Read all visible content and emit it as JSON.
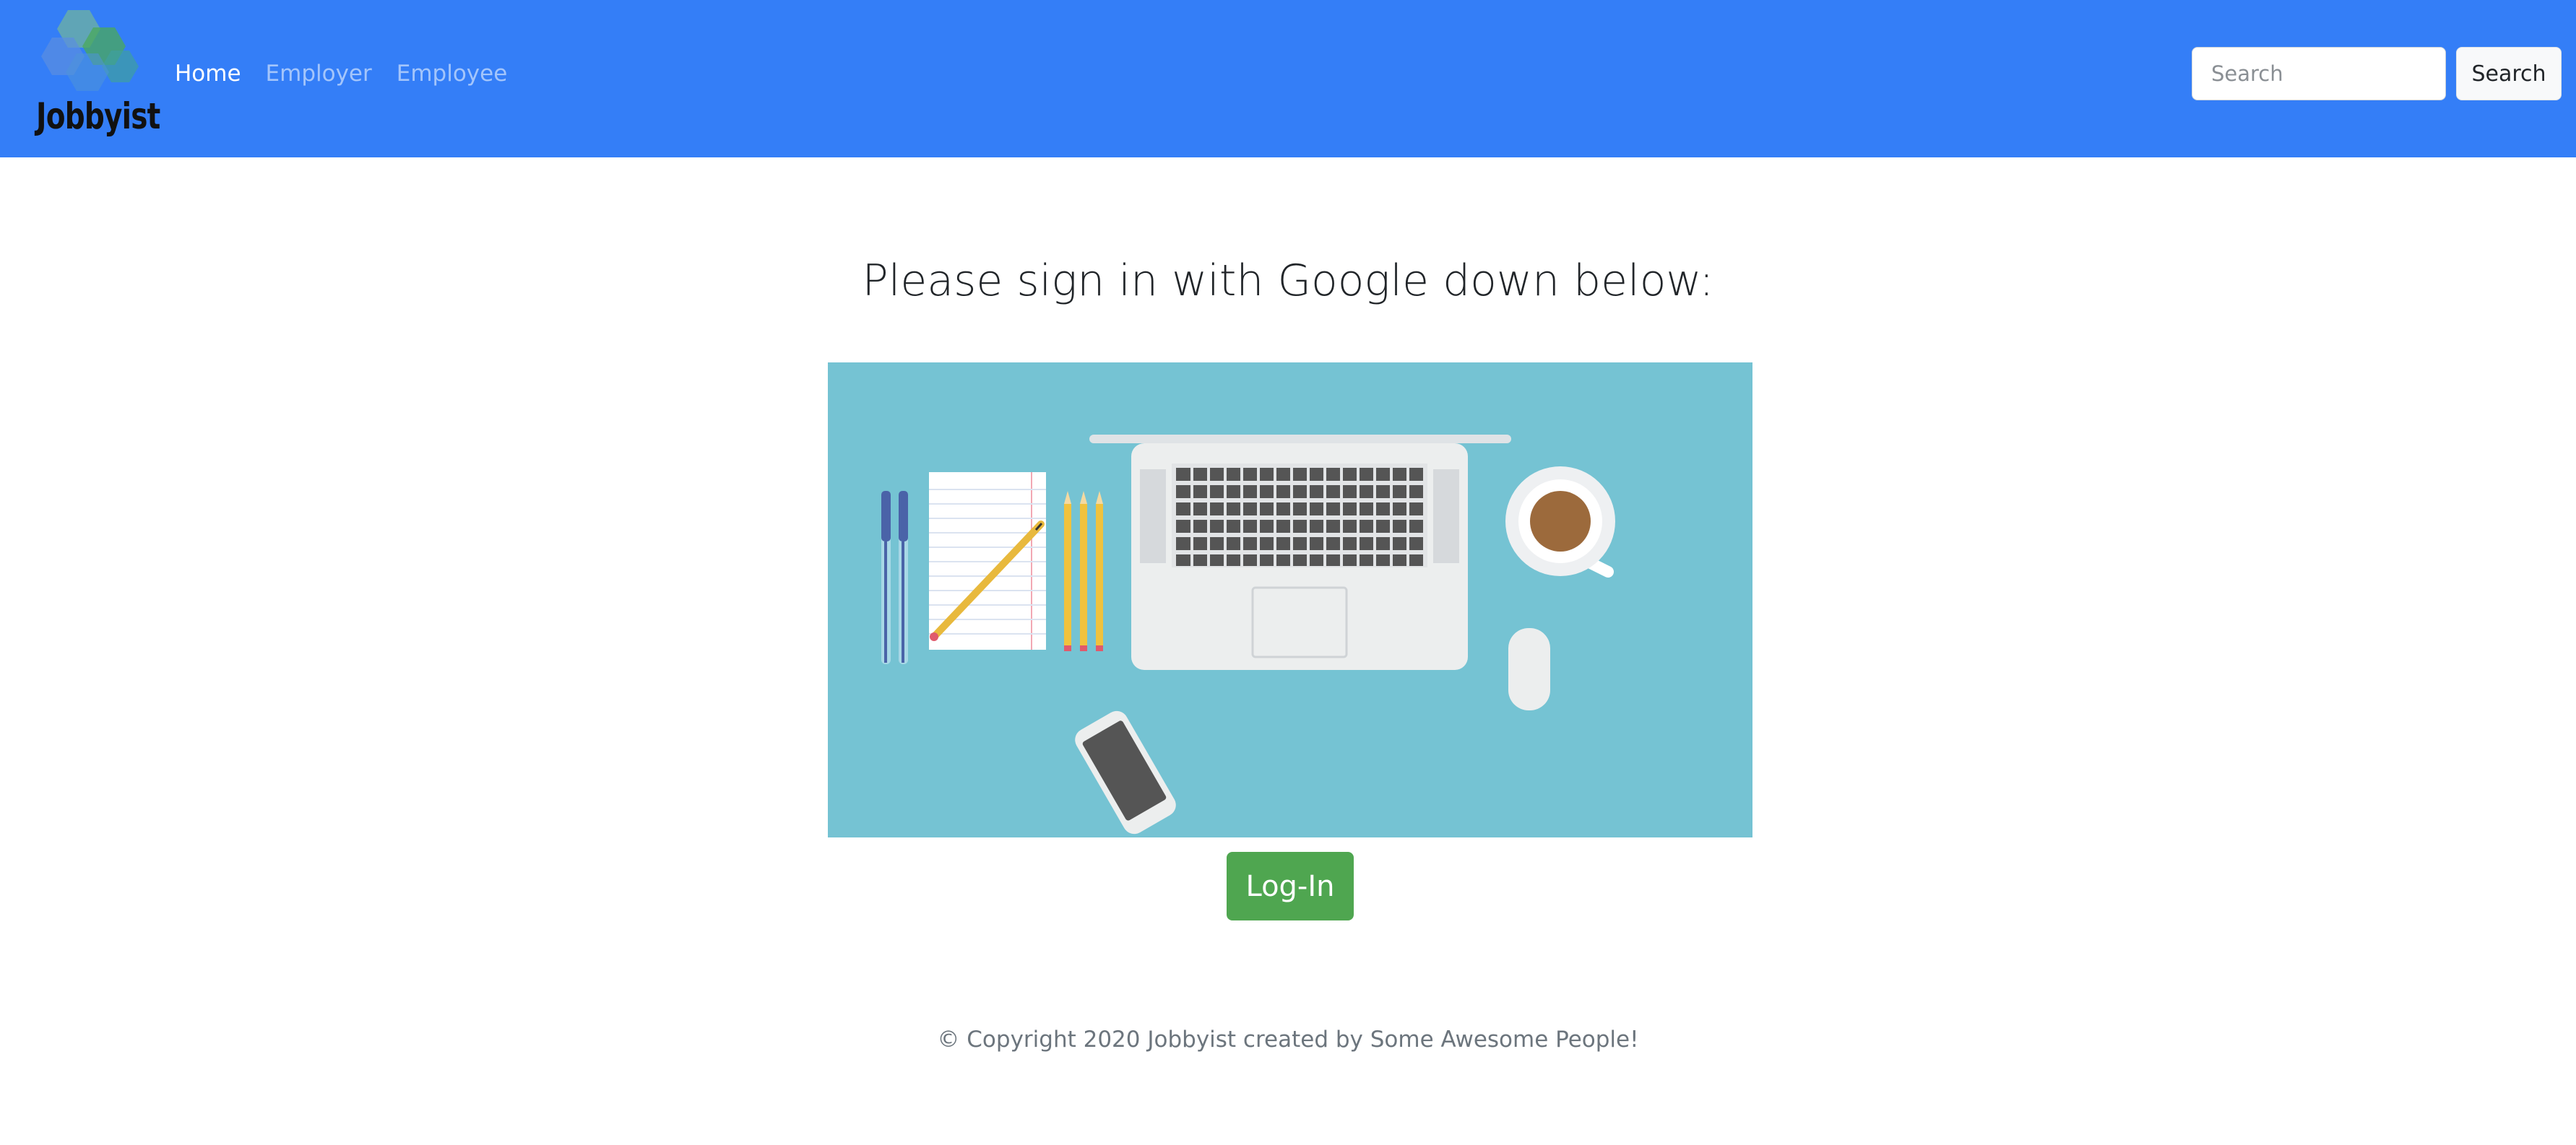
{
  "brand": {
    "name": "Jobbyist"
  },
  "nav": {
    "items": [
      {
        "label": "Home",
        "active": true
      },
      {
        "label": "Employer",
        "active": false
      },
      {
        "label": "Employee",
        "active": false
      }
    ]
  },
  "search": {
    "placeholder": "Search",
    "button_label": "Search"
  },
  "main": {
    "heading": "Please sign in with Google down below:",
    "login_label": "Log-In"
  },
  "footer": {
    "text": "© Copyright 2020 Jobbyist created by Some Awesome People!"
  },
  "colors": {
    "navbar": "#347ef7",
    "login_button": "#4fa650",
    "illustration_bg": "#75c3d3"
  }
}
